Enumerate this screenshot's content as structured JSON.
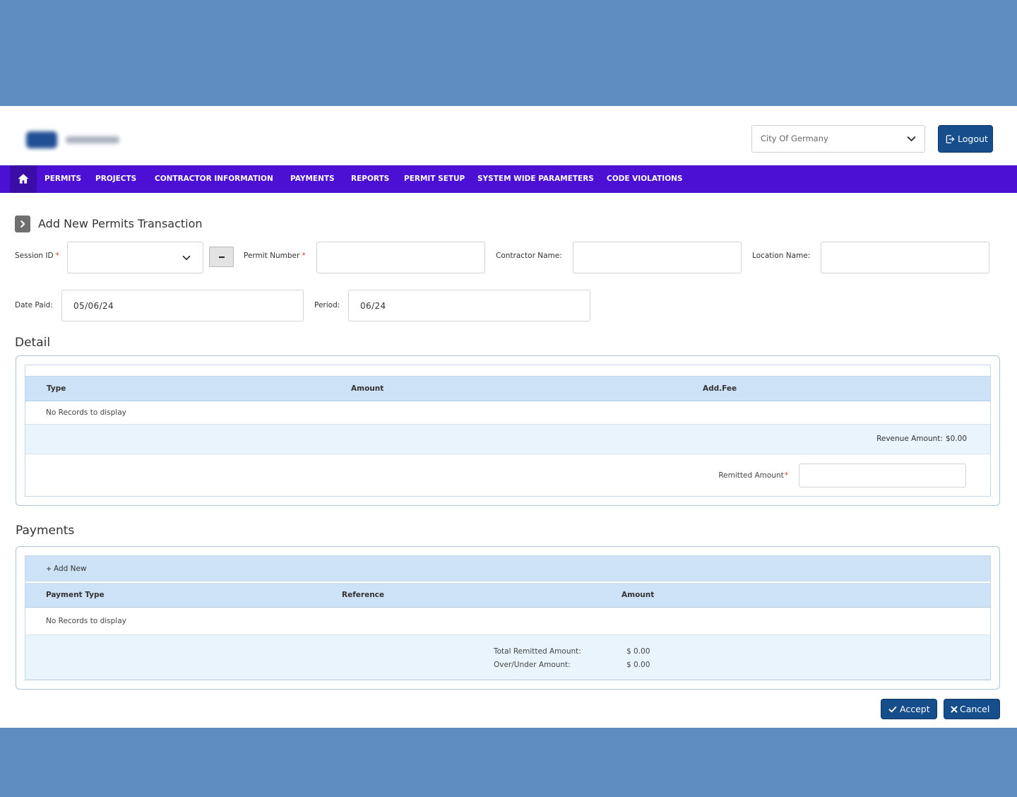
{
  "colors": {
    "background_band": "#5d8cc0",
    "nav_bar": "#4b10d3",
    "nav_home": "#3a0ca8",
    "primary_button": "#164e8b",
    "grid_header": "#cde1f7",
    "grid_footer": "#eaf4fd",
    "required": "#e53935"
  },
  "icons": {
    "home": "home-icon",
    "select_arrow": "chevron-down-icon",
    "logout": "logout-icon",
    "title": "chevron-right-icon",
    "collapse": "minus-icon",
    "add": "plus-icon",
    "accept": "check-icon",
    "cancel": "close-icon"
  },
  "header": {
    "organization_select": {
      "value": "City Of Germany"
    },
    "logout_label": "Logout"
  },
  "nav": {
    "items": [
      "PERMITS",
      "PROJECTS",
      "CONTRACTOR INFORMATION",
      "PAYMENTS",
      "REPORTS",
      "PERMIT SETUP",
      "SYSTEM WIDE PARAMETERS",
      "CODE VIOLATIONS"
    ]
  },
  "page": {
    "title": "Add New Permits Transaction"
  },
  "form": {
    "session_id": {
      "label": "Session ID",
      "required_mark": "*",
      "value": ""
    },
    "permit_number": {
      "label": "Permit Number",
      "required_mark": "*",
      "value": ""
    },
    "contractor_name": {
      "label": "Contractor Name:",
      "value": ""
    },
    "location_name": {
      "label": "Location Name:",
      "value": ""
    },
    "date_paid": {
      "label": "Date Paid:",
      "value": "05/06/24"
    },
    "period": {
      "label": "Period:",
      "value": "06/24"
    }
  },
  "detail": {
    "heading": "Detail",
    "columns": [
      "Type",
      "Amount",
      "Add.Fee"
    ],
    "empty_text": "No Records to display",
    "revenue_amount": {
      "label": "Revenue Amount:",
      "value": "$0.00"
    },
    "remitted_amount": {
      "label": "Remitted Amount",
      "required_mark": "*",
      "value": ""
    }
  },
  "payments": {
    "heading": "Payments",
    "add_new_label": "Add New",
    "columns": [
      "Payment Type",
      "Reference",
      "Amount"
    ],
    "empty_text": "No Records to display",
    "totals": [
      {
        "label": "Total Remitted Amount:",
        "value": "$ 0.00"
      },
      {
        "label": "Over/Under Amount:",
        "value": "$ 0.00"
      }
    ]
  },
  "actions": {
    "accept_label": "Accept",
    "cancel_label": "Cancel"
  }
}
